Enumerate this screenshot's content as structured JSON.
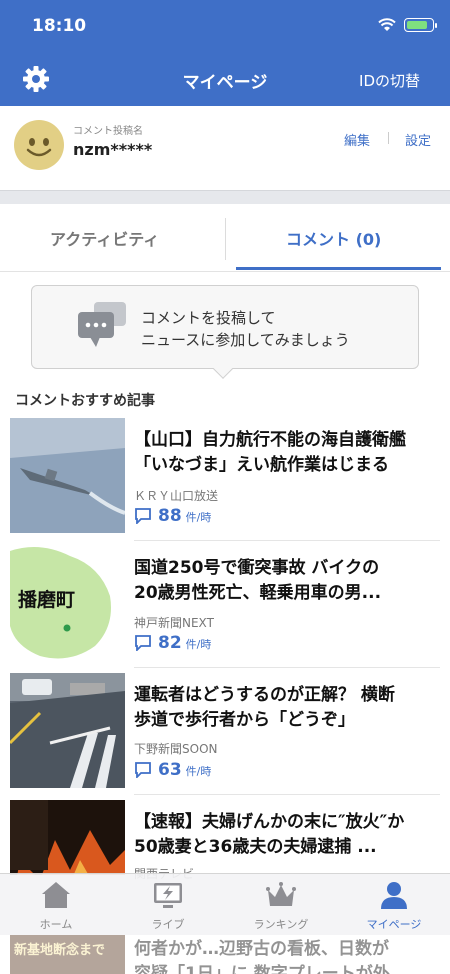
{
  "status_bar": {
    "time": "18:10"
  },
  "header": {
    "title": "マイページ",
    "id_switch_label": "IDの切替"
  },
  "profile": {
    "label": "コメント投稿名",
    "name": "nzm*****",
    "edit_label": "編集",
    "settings_label": "設定"
  },
  "tabs": [
    {
      "label": "アクティビティ",
      "active": false
    },
    {
      "label": "コメント (0)",
      "active": true
    }
  ],
  "prompt": {
    "line1": "コメントを投稿して",
    "line2": "ニュースに参加してみましょう"
  },
  "section_title": "コメントおすすめ記事",
  "articles": [
    {
      "title": "【山口】自力航行不能の海自護衛艦\n「いなづま」えい航作業はじまる",
      "source": "ＫＲＹ山口放送",
      "count": "88",
      "unit": "件/時",
      "thumb": "ship-photo"
    },
    {
      "title": "国道250号で衝突事故 バイクの\n20歳男性死亡、軽乗用車の男...",
      "source": "神戸新聞NEXT",
      "count": "82",
      "unit": "件/時",
      "thumb": "map-harima",
      "thumb_text": "播磨町"
    },
    {
      "title": "運転者はどうするのが正解？ 横断\n歩道で歩行者から「どうぞ」",
      "source": "下野新聞SOON",
      "count": "63",
      "unit": "件/時",
      "thumb": "road-photo"
    },
    {
      "title": "【速報】夫婦げんかの末に″放火″か\n50歳妻と36歳夫の夫婦逮捕 ...",
      "source": "関西テレビ",
      "count": "",
      "unit": "",
      "thumb": "fire-photo"
    }
  ],
  "partial_article": {
    "title": "何者かが…辺野古の看板、日数が\n容疑「1日」に 数字プレートが外...",
    "thumb_text": "新基地断念まで"
  },
  "bottom_nav": [
    {
      "label": "ホーム",
      "icon": "home-icon",
      "active": false
    },
    {
      "label": "ライブ",
      "icon": "live-icon",
      "active": false
    },
    {
      "label": "ランキング",
      "icon": "crown-icon",
      "active": false
    },
    {
      "label": "マイページ",
      "icon": "person-icon",
      "active": true
    }
  ],
  "colors": {
    "brand": "#3f6fc7",
    "inactive": "#888888"
  }
}
